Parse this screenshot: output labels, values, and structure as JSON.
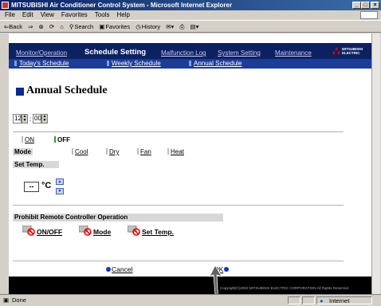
{
  "window": {
    "title": "MITSUBISHI Air Conditioner Control System - Microsoft Internet Explorer",
    "controls": [
      "_",
      "□",
      "×"
    ]
  },
  "menu": [
    "File",
    "Edit",
    "View",
    "Favorites",
    "Tools",
    "Help"
  ],
  "toolbar": {
    "back": "⇐Back",
    "forward": "⇒",
    "stop_icon": "stop-icon",
    "refresh_icon": "refresh-icon",
    "home_icon": "home-icon",
    "search": "Search",
    "favorites": "Favorites",
    "history": "History"
  },
  "nav": {
    "tabs": [
      "Monitor/Operation",
      "Schedule Setting",
      "Malfunction Log",
      "System Setting",
      "Maintenance"
    ],
    "active": "Schedule Setting",
    "subtabs": [
      "Today's Schedule",
      "Weekly Schedule",
      "Annual Schedule"
    ],
    "logo": [
      "MITSUBISHI",
      "ELECTRIC"
    ]
  },
  "page": {
    "title": "Annual Schedule",
    "hour": "12",
    "minute": "00",
    "time_separator": ":",
    "on_label": "ON",
    "off_label": "OFF",
    "mode_label": "Mode",
    "modes": [
      "Cool",
      "Dry",
      "Fan",
      "Heat"
    ],
    "set_temp_label": "Set Temp.",
    "temp_value": "--",
    "temp_unit": "°C",
    "prohibit_label": "Prohibit Remote Controller Operation",
    "prohibit_items": [
      "ON/OFF",
      "Mode",
      "Set Temp."
    ],
    "cancel": "Cancel",
    "ok": "OK",
    "copyright": "Copyright(C)2002 MITSUBISHI ELECTRIC CORPORATION All Rights Reserved."
  },
  "status": {
    "text": "Done",
    "zone": "Internet"
  },
  "colors": {
    "nav_dark": "#0c2260",
    "nav_sub": "#1c3c9c",
    "accent": "#0c2a8c",
    "on_tick": "#2ca02c"
  }
}
